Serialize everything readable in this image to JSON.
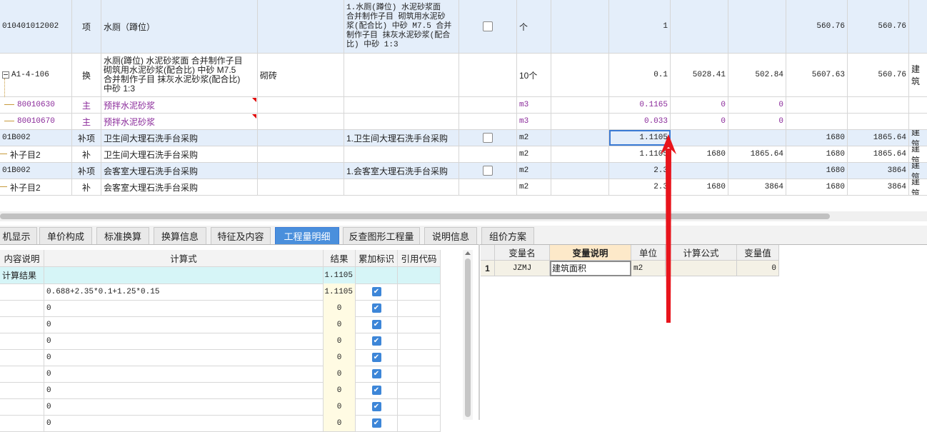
{
  "top_grid": {
    "rows": [
      {
        "code": "010401012002",
        "type": "项",
        "name": "水厕（蹲位）",
        "spec": "",
        "feature_lines": [
          "1.水厕(蹲位) 水泥砂浆面",
          "合并制作子目 砌筑用水泥砂",
          "浆(配合比) 中砂 M7.5  合并",
          "制作子目 抹灰水泥砂浆(配合",
          "比) 中砂 1:3"
        ],
        "unit": "个",
        "qty": "1",
        "c1": "",
        "c2": "",
        "c3": "560.76",
        "c4": "560.76",
        "c5": ""
      },
      {
        "code": "A1-4-106",
        "type": "换",
        "name_lines": [
          "水厕(蹲位) 水泥砂浆面  合并制作子目",
          "砌筑用水泥砂浆(配合比) 中砂 M7.5",
          "合并制作子目 抹灰水泥砂浆(配合比)",
          "中砂 1:3"
        ],
        "spec": "砌砖",
        "unit": "10个",
        "qty": "0.1",
        "c1": "5028.41",
        "c2": "502.84",
        "c3": "5607.63",
        "c4": "560.76",
        "c5": "建筑"
      },
      {
        "code": "80010630",
        "type": "主",
        "name": "预拌水泥砂浆",
        "unit": "m3",
        "qty": "0.1165",
        "c1": "0",
        "c2": "0",
        "c3": "",
        "c4": "",
        "c5": ""
      },
      {
        "code": "80010670",
        "type": "主",
        "name": "预拌水泥砂浆",
        "unit": "m3",
        "qty": "0.033",
        "c1": "0",
        "c2": "0",
        "c3": "",
        "c4": "",
        "c5": ""
      },
      {
        "code": "01B002",
        "type": "补项",
        "name": "卫生间大理石洗手台采购",
        "feature": "1.卫生间大理石洗手台采购",
        "unit": "m2",
        "qty": "1.1105",
        "c1": "",
        "c2": "",
        "c3": "1680",
        "c4": "1865.64",
        "c5": "建筑"
      },
      {
        "code": "补子目2",
        "type": "补",
        "name": "卫生间大理石洗手台采购",
        "unit": "m2",
        "qty": "1.1105",
        "c1": "1680",
        "c2": "1865.64",
        "c3": "1680",
        "c4": "1865.64",
        "c5": "建筑"
      },
      {
        "code": "01B002",
        "type": "补项",
        "name": "会客室大理石洗手台采购",
        "feature": "1.会客室大理石洗手台采购",
        "unit": "m2",
        "qty": "2.3",
        "c1": "",
        "c2": "",
        "c3": "1680",
        "c4": "3864",
        "c5": "建筑"
      },
      {
        "code": "补子目2",
        "type": "补",
        "name": "会客室大理石洗手台采购",
        "unit": "m2",
        "qty": "2.3",
        "c1": "1680",
        "c2": "3864",
        "c3": "1680",
        "c4": "3864",
        "c5": "建筑"
      }
    ]
  },
  "tabs": [
    "机显示",
    "单价构成",
    "标准换算",
    "换算信息",
    "特征及内容",
    "工程量明细",
    "反查图形工程量",
    "说明信息",
    "组价方案"
  ],
  "active_tab": "工程量明细",
  "calc_table": {
    "headers": [
      "内容说明",
      "计算式",
      "结果",
      "累加标识",
      "引用代码"
    ],
    "rows": [
      {
        "desc": "计算结果",
        "formula": "",
        "result": "1.1105",
        "checked": false,
        "ref": ""
      },
      {
        "desc": "",
        "formula": "0.688+2.35*0.1+1.25*0.15",
        "result": "1.1105",
        "checked": true,
        "ref": ""
      },
      {
        "desc": "",
        "formula": "0",
        "result": "0",
        "checked": true,
        "ref": ""
      },
      {
        "desc": "",
        "formula": "0",
        "result": "0",
        "checked": true,
        "ref": ""
      },
      {
        "desc": "",
        "formula": "0",
        "result": "0",
        "checked": true,
        "ref": ""
      },
      {
        "desc": "",
        "formula": "0",
        "result": "0",
        "checked": true,
        "ref": ""
      },
      {
        "desc": "",
        "formula": "0",
        "result": "0",
        "checked": true,
        "ref": ""
      },
      {
        "desc": "",
        "formula": "0",
        "result": "0",
        "checked": true,
        "ref": ""
      },
      {
        "desc": "",
        "formula": "0",
        "result": "0",
        "checked": true,
        "ref": ""
      },
      {
        "desc": "",
        "formula": "0",
        "result": "0",
        "checked": true,
        "ref": ""
      }
    ]
  },
  "var_table": {
    "headers": [
      "变量名",
      "变量说明",
      "单位",
      "计算公式",
      "变量值"
    ],
    "rows": [
      {
        "idx": "1",
        "name": "JZMJ",
        "desc": "建筑面积",
        "unit": "m2",
        "formula": "",
        "value": "0"
      }
    ]
  },
  "colors": {
    "selected_row": "#e4eefa",
    "active_tab": "#4a8fdc",
    "purple_text": "#8a2a9a",
    "arrow": "#e8141c"
  }
}
